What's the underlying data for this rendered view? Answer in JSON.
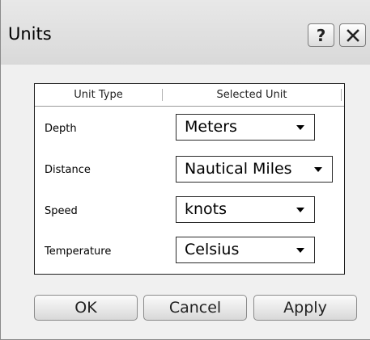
{
  "dialog": {
    "title": "Units",
    "help_glyph": "?",
    "close_icon": "close-icon"
  },
  "table": {
    "headers": [
      "Unit Type",
      "Selected Unit"
    ],
    "rows": [
      {
        "label": "Depth",
        "value": "Meters"
      },
      {
        "label": "Distance",
        "value": "Nautical Miles"
      },
      {
        "label": "Speed",
        "value": "knots"
      },
      {
        "label": "Temperature",
        "value": "Celsius"
      }
    ]
  },
  "buttons": {
    "ok": "OK",
    "cancel": "Cancel",
    "apply": "Apply"
  }
}
